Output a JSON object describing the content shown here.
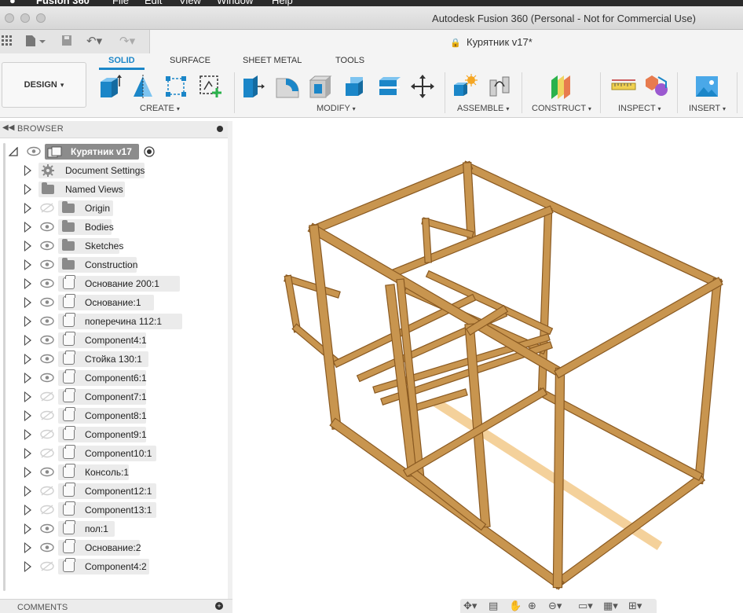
{
  "mac_menu": {
    "app": "Fusion 360",
    "items": [
      "File",
      "Edit",
      "View",
      "Window",
      "Help"
    ]
  },
  "window": {
    "title": "Autodesk Fusion 360 (Personal - Not for Commercial Use)"
  },
  "document": {
    "title": "Курятник v17*"
  },
  "ribbon": {
    "workspace": "DESIGN",
    "tabs": [
      "SOLID",
      "SURFACE",
      "SHEET METAL",
      "TOOLS"
    ],
    "active_tab": "SOLID",
    "groups": [
      {
        "label": "CREATE"
      },
      {
        "label": "MODIFY"
      },
      {
        "label": "ASSEMBLE"
      },
      {
        "label": "CONSTRUCT"
      },
      {
        "label": "INSPECT"
      },
      {
        "label": "INSERT"
      }
    ],
    "accent": "#1b86c8"
  },
  "browser": {
    "title": "BROWSER",
    "root": "Курятник v17",
    "items": [
      {
        "label": "Document Settings",
        "icon": "gear-icon",
        "eye": "none"
      },
      {
        "label": "Named Views",
        "icon": "folder-icon",
        "eye": "none"
      },
      {
        "label": "Origin",
        "icon": "folder-icon",
        "eye": "hidden"
      },
      {
        "label": "Bodies",
        "icon": "folder-icon",
        "eye": "visible"
      },
      {
        "label": "Sketches",
        "icon": "folder-icon",
        "eye": "visible"
      },
      {
        "label": "Construction",
        "icon": "folder-icon",
        "eye": "visible"
      },
      {
        "label": "Основание 200:1",
        "icon": "component-icon",
        "eye": "visible"
      },
      {
        "label": "Основание:1",
        "icon": "component-icon",
        "eye": "visible"
      },
      {
        "label": "поперечина 112:1",
        "icon": "component-icon",
        "eye": "visible"
      },
      {
        "label": "Component4:1",
        "icon": "component-icon",
        "eye": "visible"
      },
      {
        "label": "Стойка 130:1",
        "icon": "component-icon",
        "eye": "visible"
      },
      {
        "label": "Component6:1",
        "icon": "component-icon",
        "eye": "visible"
      },
      {
        "label": "Component7:1",
        "icon": "component-icon",
        "eye": "hidden"
      },
      {
        "label": "Component8:1",
        "icon": "component-icon",
        "eye": "hidden"
      },
      {
        "label": "Component9:1",
        "icon": "component-icon",
        "eye": "hidden"
      },
      {
        "label": "Component10:1",
        "icon": "component-icon",
        "eye": "hidden"
      },
      {
        "label": "Консоль:1",
        "icon": "component-icon",
        "eye": "visible"
      },
      {
        "label": "Component12:1",
        "icon": "component-icon",
        "eye": "hidden"
      },
      {
        "label": "Component13:1",
        "icon": "component-icon",
        "eye": "hidden"
      },
      {
        "label": "пол:1",
        "icon": "component-icon",
        "eye": "visible"
      },
      {
        "label": "Основание:2",
        "icon": "component-icon",
        "eye": "visible"
      },
      {
        "label": "Component4:2",
        "icon": "component-icon",
        "eye": "hidden"
      }
    ]
  },
  "comments": {
    "title": "COMMENTS"
  },
  "colors": {
    "wood": "#c8954f",
    "wood_dark": "#8a5a22",
    "floor_board": "#f3c98a"
  }
}
